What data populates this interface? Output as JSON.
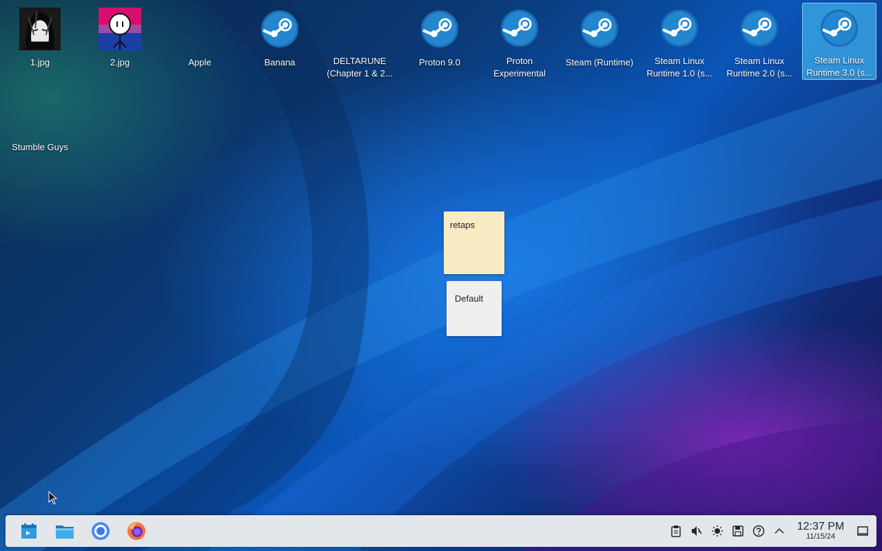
{
  "desktop": {
    "icons": [
      {
        "label": "1.jpg",
        "type": "image"
      },
      {
        "label": "2.jpg",
        "type": "image"
      },
      {
        "label": "Apple",
        "type": "blank"
      },
      {
        "label": "Banana",
        "type": "steam"
      },
      {
        "label": "DELTARUNE (Chapter 1 & 2...",
        "type": "blank"
      },
      {
        "label": "Proton 9.0",
        "type": "steam"
      },
      {
        "label": "Proton Experimental",
        "type": "steam"
      },
      {
        "label": "Steam (Runtime)",
        "type": "steam"
      },
      {
        "label": "Steam Linux Runtime 1.0 (s...",
        "type": "steam"
      },
      {
        "label": "Steam Linux Runtime 2.0 (s...",
        "type": "steam"
      },
      {
        "label": "Steam Linux Runtime 3.0 (s...",
        "type": "steam",
        "selected": true
      },
      {
        "label": "Stumble Guys",
        "type": "blank"
      }
    ]
  },
  "notes": {
    "yellow": {
      "text": "retaps"
    },
    "white": {
      "text": "Default"
    }
  },
  "taskbar": {
    "apps": [
      "application-launcher-icon",
      "file-manager-icon",
      "chromium-browser-icon",
      "firefox-browser-icon"
    ],
    "tray": [
      "clipboard-icon",
      "volume-muted-icon",
      "brightness-icon",
      "save-icon",
      "help-icon",
      "expand-arrow-icon"
    ],
    "clock": {
      "time": "12:37 PM",
      "date": "11/15/24"
    }
  },
  "colors": {
    "selection": "#3daee9",
    "taskbar": "#e3e6ea",
    "steam_blue": "#1a6fb5",
    "note_yellow": "#f7ebc3"
  }
}
